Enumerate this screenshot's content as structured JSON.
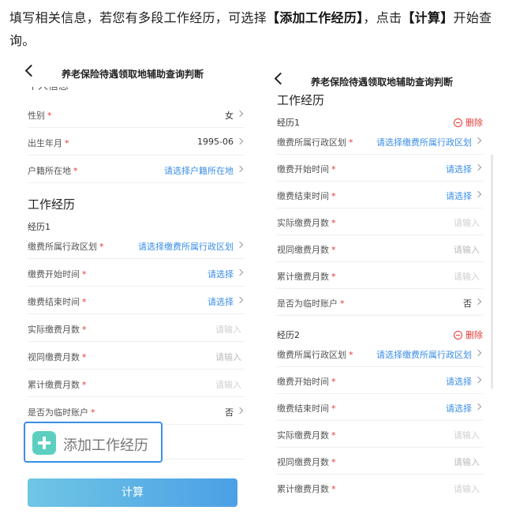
{
  "intro": {
    "p1": "填写相关信息，若您有多段工作经历，可选择",
    "b1": "【添加工作经历】",
    "p2": "，点击",
    "b2": "【计算】",
    "p3": "开始查询。"
  },
  "left": {
    "title": "养老保险待遇领取地辅助查询判断",
    "partial_section": "个人信息",
    "rows": [
      {
        "label": "性别",
        "value": "女"
      },
      {
        "label": "出生年月",
        "value": "1995-06"
      },
      {
        "label": "户籍所在地",
        "value": "请选择户籍所在地"
      }
    ],
    "work_title": "工作经历",
    "exp_label": "经历1",
    "exp_rows": [
      {
        "label": "缴费所属行政区划",
        "value": "请选择缴费所属行政区划"
      },
      {
        "label": "缴费开始时间",
        "value": "请选择"
      },
      {
        "label": "缴费结束时间",
        "value": "请选择"
      },
      {
        "label": "实际缴费月数",
        "value": "请输入"
      },
      {
        "label": "视同缴费月数",
        "value": "请输入"
      },
      {
        "label": "累计缴费月数",
        "value": "请输入"
      },
      {
        "label": "是否为临时账户",
        "value": "否"
      }
    ],
    "add_label": "添加工作经历",
    "calc_label": "计算"
  },
  "right": {
    "title": "养老保险待遇领取地辅助查询判断",
    "work_title": "工作经历",
    "delete_label": "删除",
    "exp1_label": "经历1",
    "exp2_label": "经历2",
    "exp1_rows": [
      {
        "label": "缴费所属行政区划",
        "value": "请选择缴费所属行政区划"
      },
      {
        "label": "缴费开始时间",
        "value": "请选择"
      },
      {
        "label": "缴费结束时间",
        "value": "请选择"
      },
      {
        "label": "实际缴费月数",
        "value": "请输入"
      },
      {
        "label": "视同缴费月数",
        "value": "请输入"
      },
      {
        "label": "累计缴费月数",
        "value": "请输入"
      },
      {
        "label": "是否为临时账户",
        "value": "否"
      }
    ],
    "exp2_rows": [
      {
        "label": "缴费所属行政区划",
        "value": "请选择缴费所属行政区划"
      },
      {
        "label": "缴费开始时间",
        "value": "请选择"
      },
      {
        "label": "缴费结束时间",
        "value": "请选择"
      },
      {
        "label": "实际缴费月数",
        "value": "请输入"
      },
      {
        "label": "视同缴费月数",
        "value": "请输入"
      },
      {
        "label": "累计缴费月数",
        "value": "请输入"
      }
    ]
  },
  "required_mark": "*",
  "colors": {
    "link": "#3a8ee6",
    "required": "#e53935",
    "add_icon": "#5ccfc0",
    "highlight_border": "#3a8ee6"
  },
  "icons": [
    "back-arrow-icon",
    "chevron-right-icon",
    "delete-circle-icon",
    "plus-icon"
  ]
}
